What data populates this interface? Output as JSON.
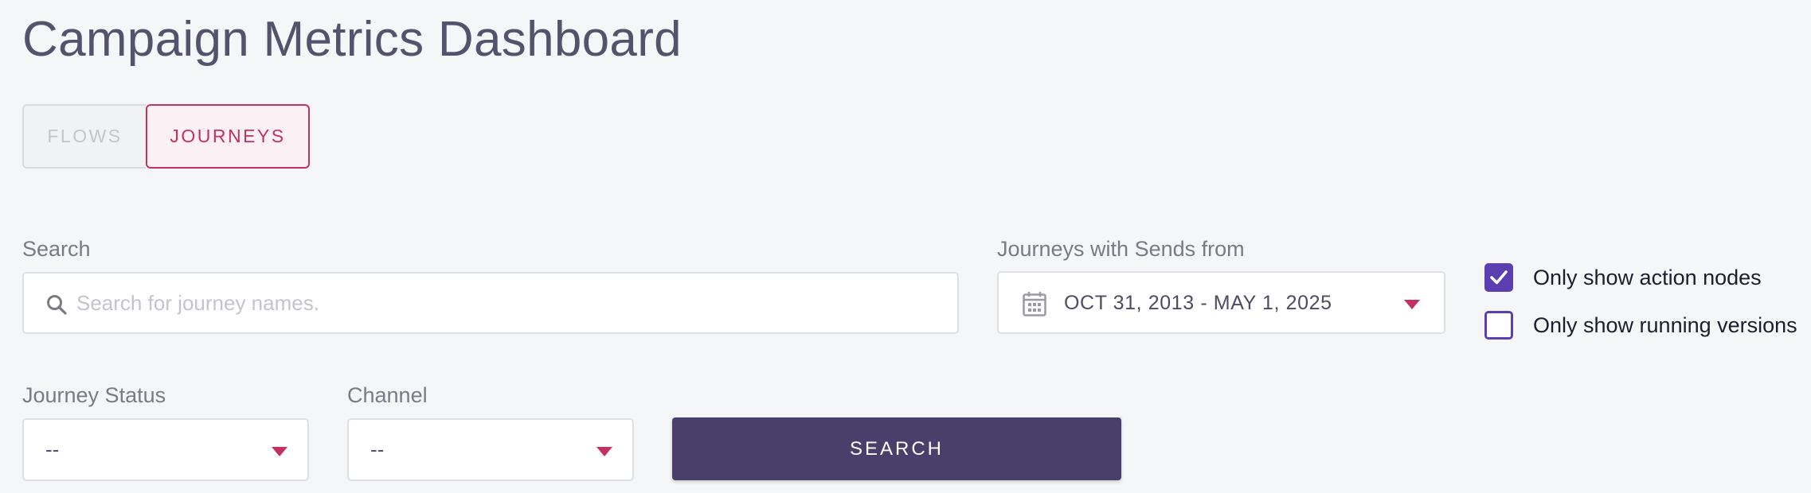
{
  "page_title": "Campaign Metrics Dashboard",
  "tabs": [
    {
      "label": "FLOWS",
      "active": false
    },
    {
      "label": "JOURNEYS",
      "active": true
    }
  ],
  "search": {
    "label": "Search",
    "placeholder": "Search for journey names.",
    "value": ""
  },
  "date_filter": {
    "label": "Journeys with Sends from",
    "value": "OCT 31, 2013 - MAY 1, 2025"
  },
  "checkboxes": [
    {
      "label": "Only show action nodes",
      "checked": true
    },
    {
      "label": "Only show running versions",
      "checked": false
    }
  ],
  "journey_status": {
    "label": "Journey Status",
    "value": "--"
  },
  "channel": {
    "label": "Channel",
    "value": "--"
  },
  "search_button": {
    "label": "SEARCH"
  },
  "colors": {
    "accent": "#c3325f",
    "primary_button": "#4a3f6b",
    "checkbox": "#5b3fb0"
  },
  "icons": [
    "search-icon",
    "calendar-icon",
    "caret-down-icon",
    "check-icon"
  ]
}
